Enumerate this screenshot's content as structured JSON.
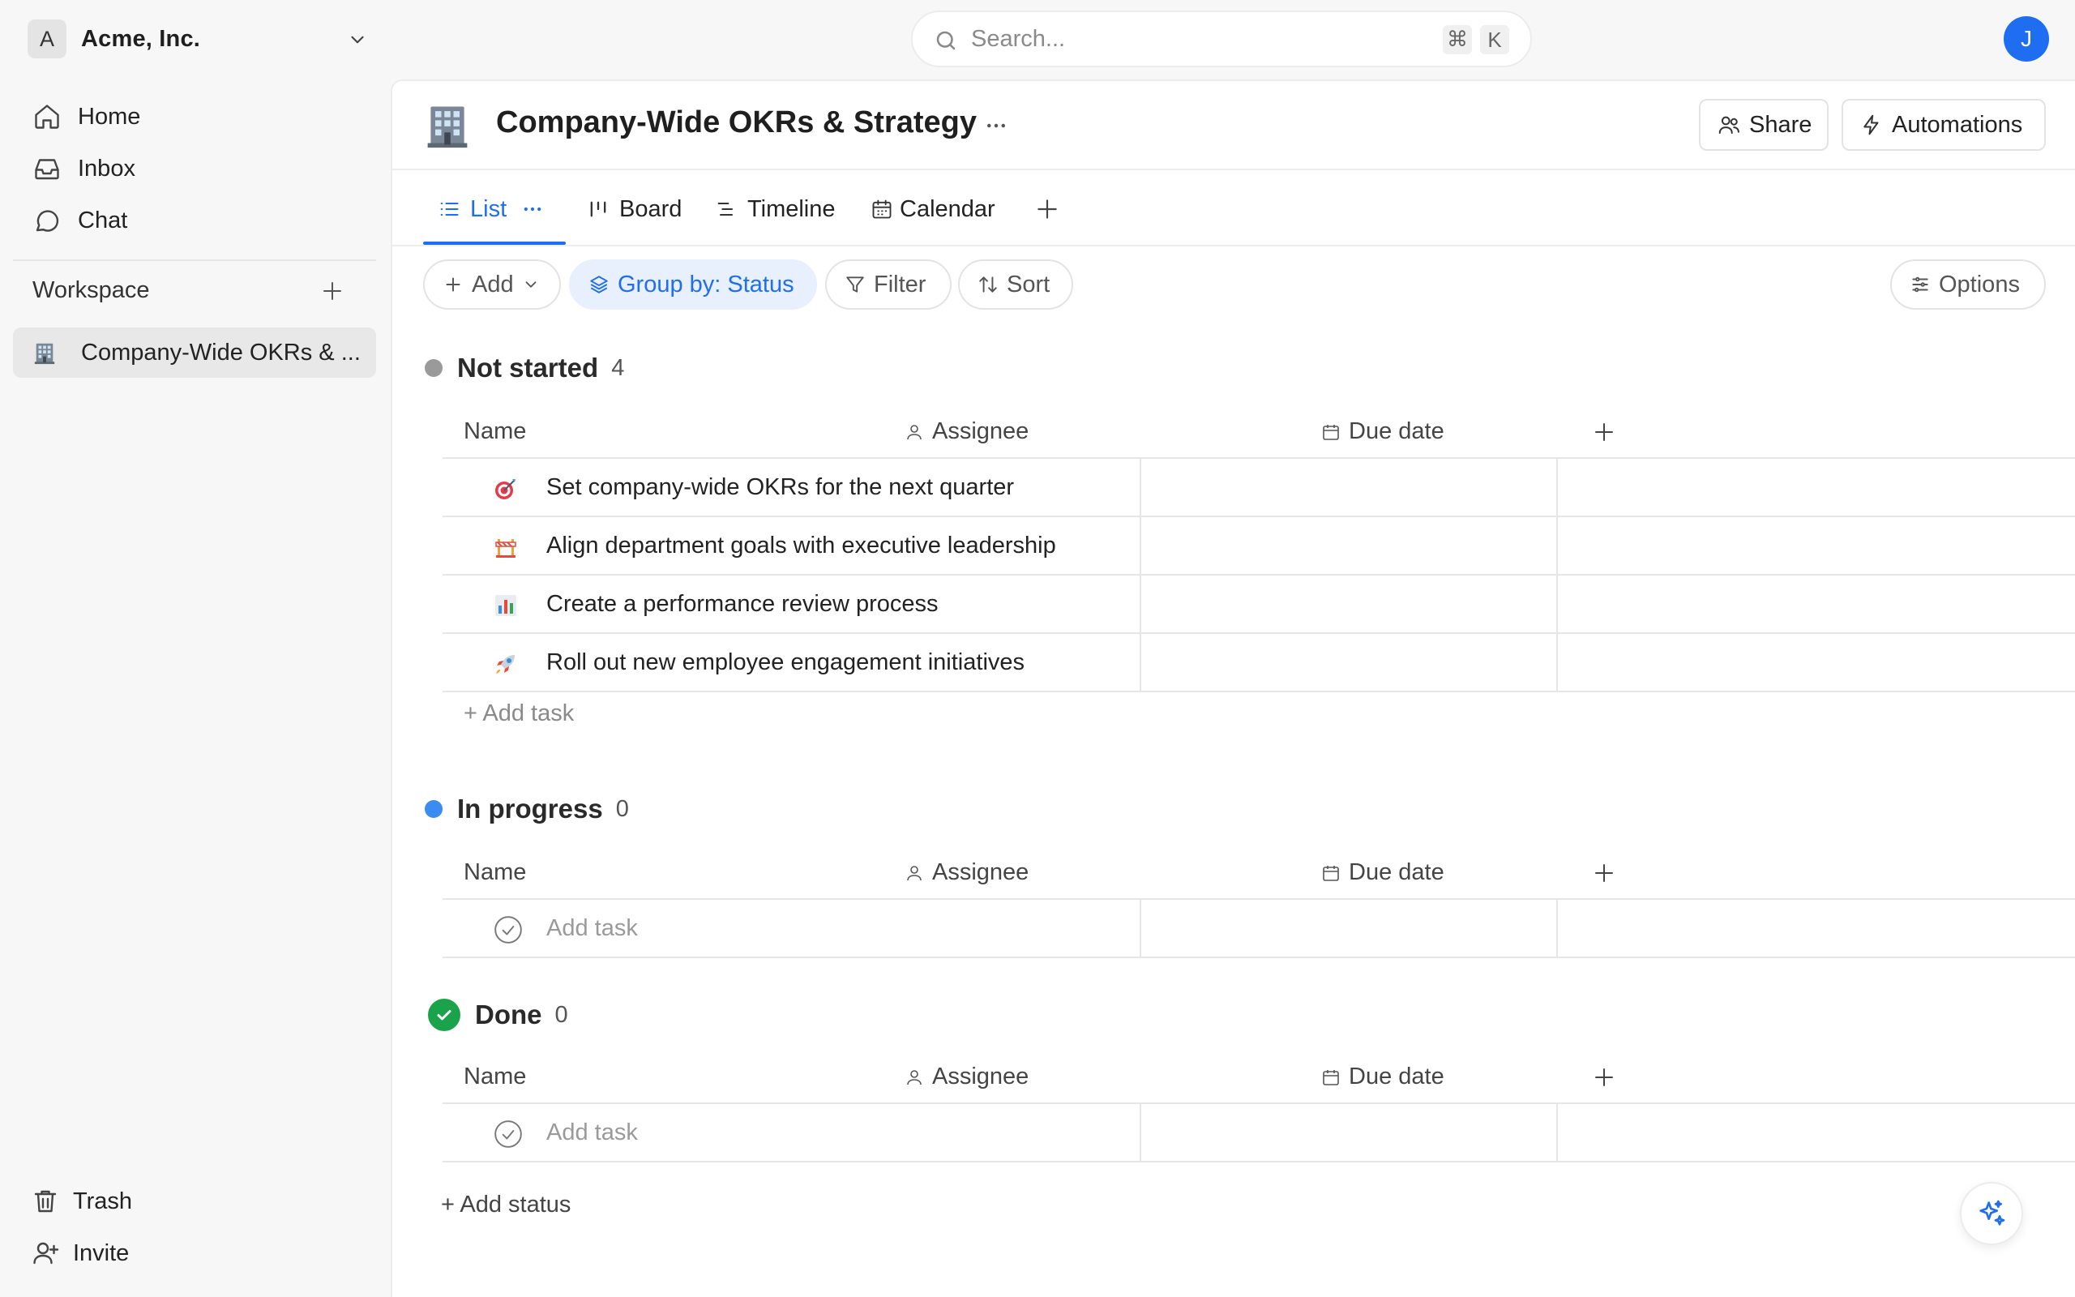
{
  "org": {
    "initial": "A",
    "name": "Acme, Inc."
  },
  "search": {
    "placeholder": "Search...",
    "shortcut_mod": "⌘",
    "shortcut_key": "K"
  },
  "user": {
    "initial": "J"
  },
  "sidebar": {
    "nav": [
      {
        "label": "Home",
        "icon": "home-icon"
      },
      {
        "label": "Inbox",
        "icon": "inbox-icon"
      },
      {
        "label": "Chat",
        "icon": "chat-icon"
      }
    ],
    "workspace_title": "Workspace",
    "workspace_items": [
      {
        "label": "Company-Wide OKRs & ...",
        "icon": "office-building-icon"
      }
    ],
    "bottom": [
      {
        "label": "Trash",
        "icon": "trash-icon"
      },
      {
        "label": "Invite",
        "icon": "invite-user-icon"
      }
    ]
  },
  "page": {
    "title": "Company-Wide OKRs & Strategy",
    "share_label": "Share",
    "automations_label": "Automations"
  },
  "tabs": [
    {
      "label": "List",
      "active": true
    },
    {
      "label": "Board"
    },
    {
      "label": "Timeline"
    },
    {
      "label": "Calendar"
    }
  ],
  "toolbar": {
    "add_label": "Add",
    "group_label": "Group by: Status",
    "filter_label": "Filter",
    "sort_label": "Sort",
    "options_label": "Options"
  },
  "columns": {
    "name": "Name",
    "assignee": "Assignee",
    "due": "Due date"
  },
  "groups": [
    {
      "name": "Not started",
      "count": "4",
      "color": "#9a9a9a",
      "tasks": [
        {
          "title": "Set company-wide OKRs for the next quarter",
          "icon": "target-icon"
        },
        {
          "title": "Align department goals with executive leadership",
          "icon": "construction-icon"
        },
        {
          "title": "Create a performance review process",
          "icon": "bar-chart-icon"
        },
        {
          "title": "Roll out new employee engagement initiatives",
          "icon": "rocket-icon"
        }
      ],
      "add_task_label": "+ Add task"
    },
    {
      "name": "In progress",
      "count": "0",
      "color": "#3b8cf0",
      "add_task_placeholder": "Add task"
    },
    {
      "name": "Done",
      "count": "0",
      "color": "#1aa34a",
      "add_task_placeholder": "Add task"
    }
  ],
  "add_status_label": "+ Add status"
}
